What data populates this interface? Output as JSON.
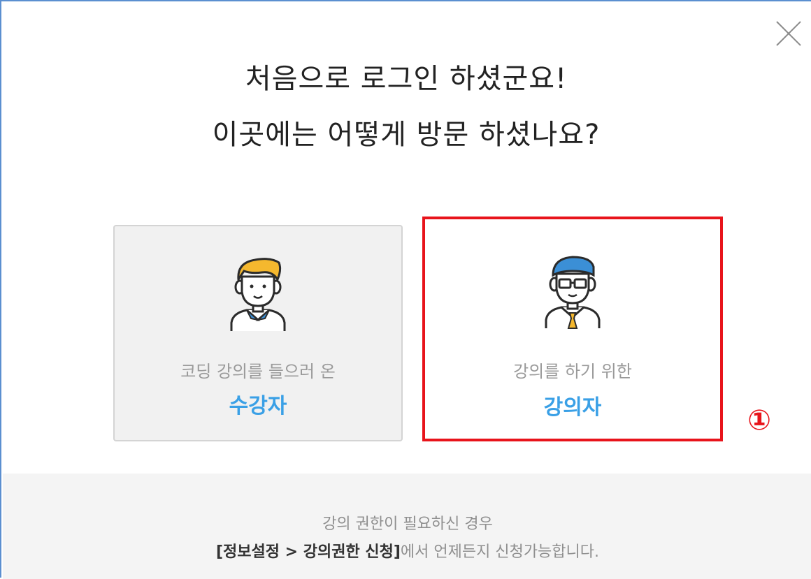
{
  "modal": {
    "close_icon": "close-icon",
    "title_line1": "처음으로 로그인 하셨군요!",
    "title_line2": "이곳에는 어떻게 방문 하셨나요?"
  },
  "options": {
    "student": {
      "subtitle": "코딩 강의를 들으러 온",
      "role": "수강자",
      "icon": "student-avatar-icon"
    },
    "teacher": {
      "subtitle": "강의를 하기 위한",
      "role": "강의자",
      "icon": "teacher-avatar-icon"
    }
  },
  "annotation": {
    "marker": "①",
    "color": "#e8141b"
  },
  "footer": {
    "line1": "강의 권한이 필요하신 경우",
    "line2_strong": "[정보설정 > 강의권한 신청]",
    "line2_rest": "에서 언제든지 신청가능합니다."
  },
  "colors": {
    "role_text": "#3aa0e6",
    "highlight_border": "#e8141b",
    "student_hair": "#f5b82e",
    "teacher_hair": "#3b8fd6"
  }
}
